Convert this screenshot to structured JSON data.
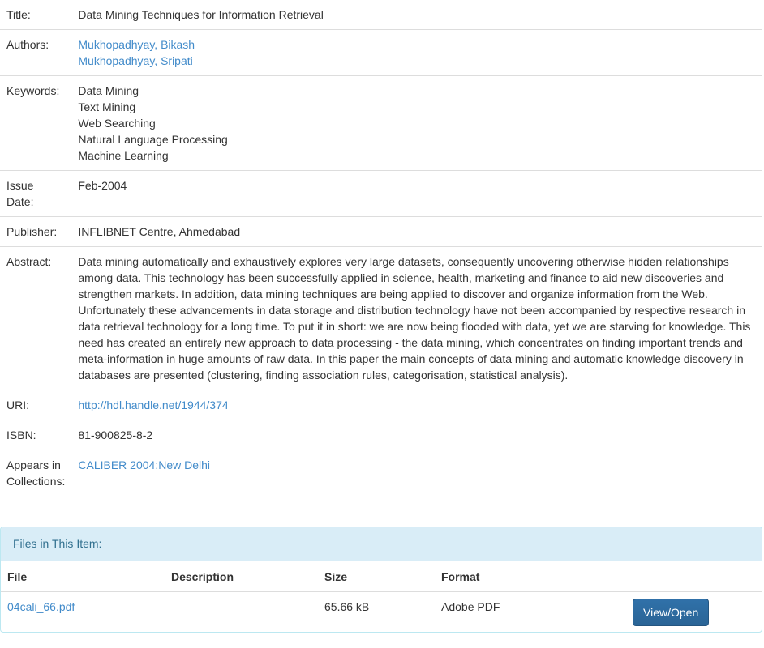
{
  "metadata": {
    "title_label": "Title:",
    "title_value": "Data Mining Techniques for Information Retrieval",
    "authors_label": "Authors:",
    "authors": [
      "Mukhopadhyay, Bikash",
      "Mukhopadhyay, Sripati"
    ],
    "keywords_label": "Keywords:",
    "keywords": [
      "Data Mining",
      "Text Mining",
      "Web Searching",
      "Natural Language Processing",
      "Machine Learning"
    ],
    "issue_date_label_1": "Issue",
    "issue_date_label_2": "Date:",
    "issue_date_value": "Feb-2004",
    "publisher_label": "Publisher:",
    "publisher_value": "INFLIBNET Centre, Ahmedabad",
    "abstract_label": "Abstract:",
    "abstract_value": "Data mining automatically and exhaustively explores very large datasets, consequently uncovering otherwise hidden relationships among data. This technology has been successfully applied in science, health, marketing and finance to aid new discoveries and strengthen markets. In addition, data mining techniques are being applied to discover and organize information from the Web. Unfortunately these advancements in data storage and distribution technology have not been accompanied by respective research in data retrieval technology for a long time. To put it in short: we are now being flooded with data, yet we are starving for knowledge. This need has created an entirely new approach to data processing - the data mining, which concentrates on finding important trends and meta-information in huge amounts of raw data. In this paper the main concepts of data mining and automatic knowledge discovery in databases are presented (clustering, finding association rules, categorisation, statistical analysis).",
    "uri_label": "URI:",
    "uri_value": "http://hdl.handle.net/1944/374",
    "isbn_label": "ISBN:",
    "isbn_value": "81-900825-8-2",
    "collections_label_1": "Appears in",
    "collections_label_2": "Collections:",
    "collections_value": "CALIBER 2004:New Delhi"
  },
  "files": {
    "heading": "Files in This Item:",
    "columns": [
      "File",
      "Description",
      "Size",
      "Format"
    ],
    "rows": [
      {
        "file": "04cali_66.pdf",
        "description": "",
        "size": "65.66 kB",
        "format": "Adobe PDF",
        "action": "View/Open"
      }
    ]
  },
  "colors": {
    "link": "#428bca",
    "panel_heading_bg": "#d9edf7",
    "panel_heading_text": "#31708f",
    "button_bg": "#2a6496"
  }
}
